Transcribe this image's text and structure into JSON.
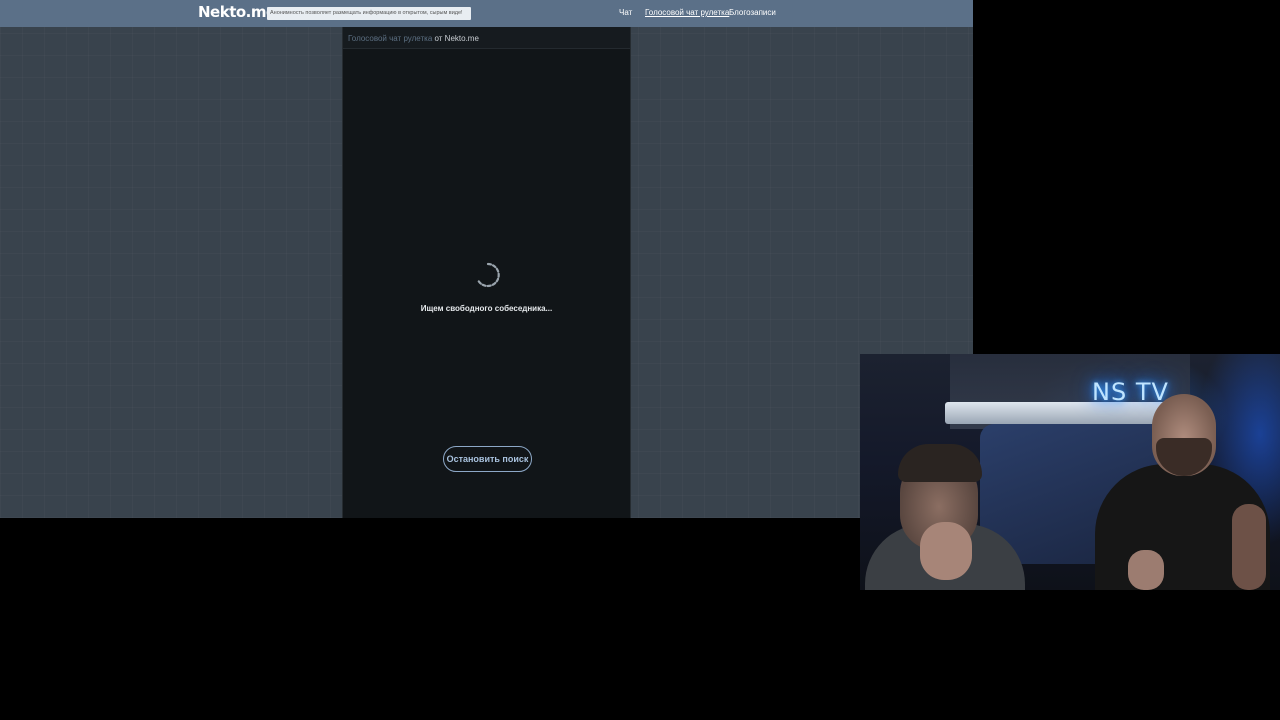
{
  "site": {
    "logo": "Nekto.me",
    "notice": "Анонимность позволяет размещать информацию в открытом, сырым виде!",
    "nav": [
      {
        "label": "Чат",
        "active": false
      },
      {
        "label": "Голосовой чат рулетка",
        "active": true
      },
      {
        "label": "Блогозаписи",
        "active": false
      }
    ]
  },
  "panel": {
    "breadcrumb_link": "Голосовой чат рулетка",
    "breadcrumb_suffix": " от Nekto.me",
    "search_status": "Ищем свободного собеседника...",
    "stop_button": "Остановить поиск"
  },
  "webcam": {
    "neon_sign": "NS TV"
  },
  "colors": {
    "topbar": "#5b7088",
    "page_bg": "#39434d",
    "panel_bg": "#111518",
    "accent": "#8da8c7"
  }
}
